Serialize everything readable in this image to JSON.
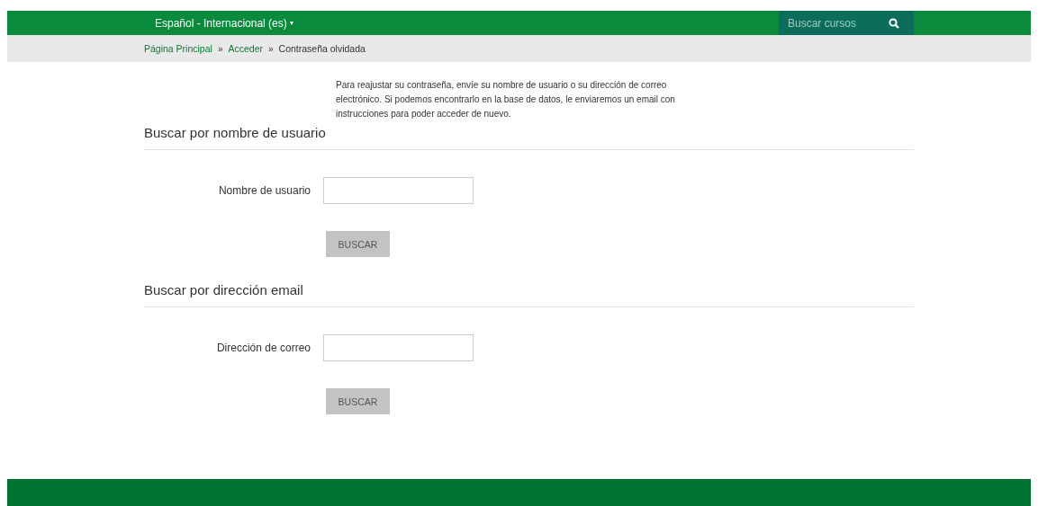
{
  "navbar": {
    "language": "Español - Internacional (es)",
    "language_caret": "▾",
    "search": {
      "placeholder": "Buscar cursos"
    }
  },
  "breadcrumb": [
    {
      "label": "Página Principal",
      "link": true
    },
    {
      "label": "Acceder",
      "link": true
    },
    {
      "label": "Contraseña olvidada",
      "link": false
    }
  ],
  "breadcrumb_separator": "»",
  "intro": "Para reajustar su contraseña, envíe su nombre de usuario o su dirección de correo electrónico. Si podemos encontrarlo en la base de datos, le enviaremos un email con instrucciones para poder acceder de nuevo.",
  "sections": [
    {
      "heading": "Buscar por nombre de usuario",
      "field_label": "Nombre de usuario",
      "button": "BUSCAR"
    },
    {
      "heading": "Buscar por dirección email",
      "field_label": "Dirección de correo",
      "button": "BUSCAR"
    }
  ]
}
